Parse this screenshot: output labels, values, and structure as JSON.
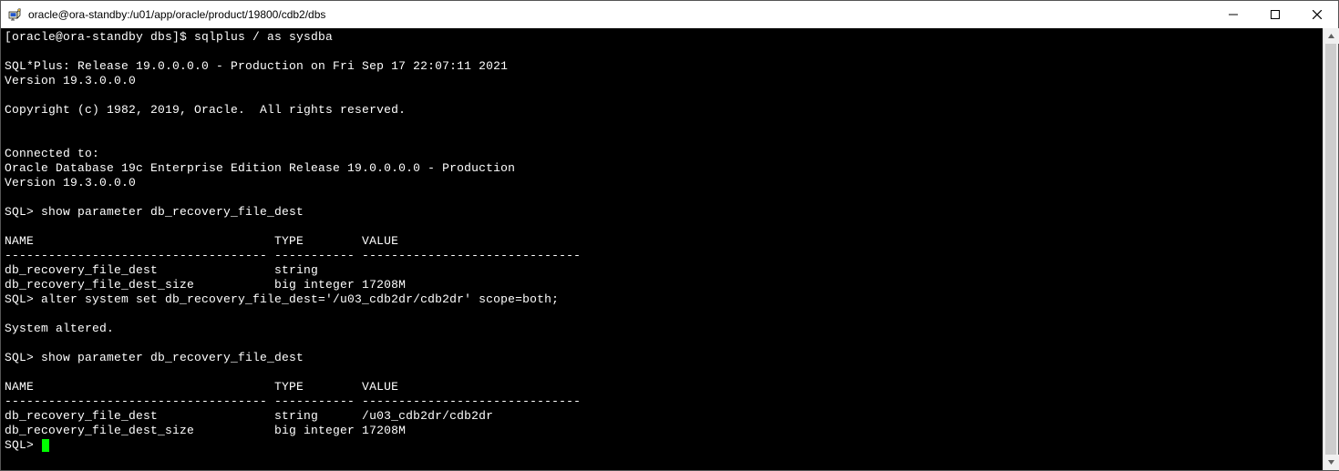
{
  "window": {
    "title": "oracle@ora-standby:/u01/app/oracle/product/19800/cdb2/dbs"
  },
  "terminal": {
    "lines": [
      "[oracle@ora-standby dbs]$ sqlplus / as sysdba",
      "",
      "SQL*Plus: Release 19.0.0.0.0 - Production on Fri Sep 17 22:07:11 2021",
      "Version 19.3.0.0.0",
      "",
      "Copyright (c) 1982, 2019, Oracle.  All rights reserved.",
      "",
      "",
      "Connected to:",
      "Oracle Database 19c Enterprise Edition Release 19.0.0.0.0 - Production",
      "Version 19.3.0.0.0",
      "",
      "SQL> show parameter db_recovery_file_dest",
      "",
      "NAME                                 TYPE        VALUE",
      "------------------------------------ ----------- ------------------------------",
      "db_recovery_file_dest                string",
      "db_recovery_file_dest_size           big integer 17208M",
      "SQL> alter system set db_recovery_file_dest='/u03_cdb2dr/cdb2dr' scope=both;",
      "",
      "System altered.",
      "",
      "SQL> show parameter db_recovery_file_dest",
      "",
      "NAME                                 TYPE        VALUE",
      "------------------------------------ ----------- ------------------------------",
      "db_recovery_file_dest                string      /u03_cdb2dr/cdb2dr",
      "db_recovery_file_dest_size           big integer 17208M"
    ],
    "final_prompt": "SQL> "
  }
}
